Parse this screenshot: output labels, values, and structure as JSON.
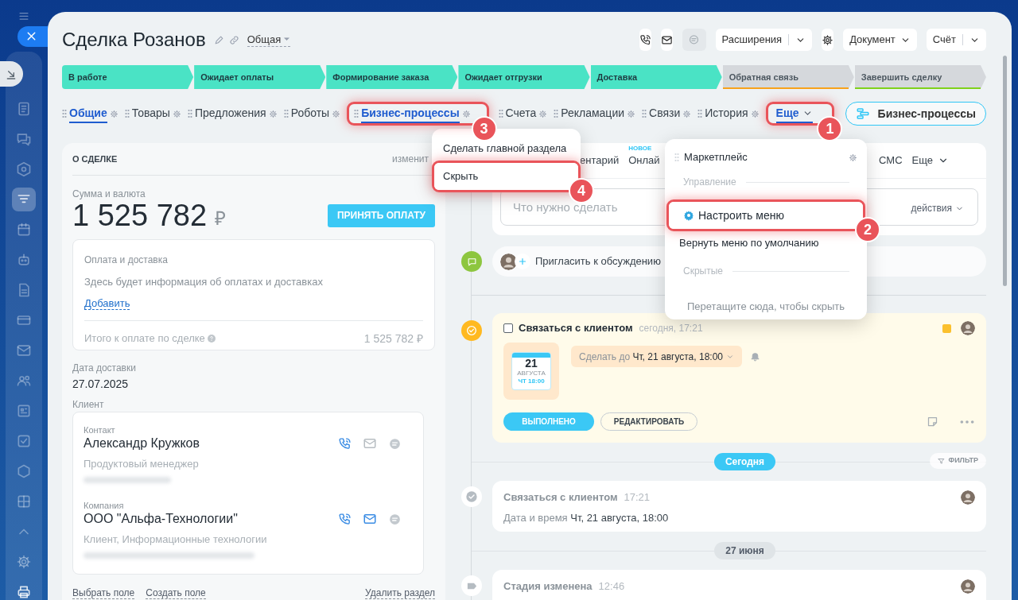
{
  "header": {
    "title": "Сделка Розанов",
    "category": "Общая",
    "buttons": [
      {
        "kind": "call",
        "disabled": false
      },
      {
        "kind": "email",
        "disabled": false
      },
      {
        "kind": "chat",
        "disabled": true
      },
      {
        "kind": "split",
        "label": "Расширения",
        "disabled": false
      },
      {
        "kind": "settings",
        "disabled": false
      },
      {
        "kind": "dropdown",
        "label": "Документ",
        "disabled": false
      },
      {
        "kind": "split",
        "label": "Счёт",
        "disabled": false
      }
    ]
  },
  "stages": [
    {
      "label": "В работе",
      "passed": true
    },
    {
      "label": "Ожидает оплаты",
      "passed": true
    },
    {
      "label": "Формирование заказа",
      "passed": true
    },
    {
      "label": "Ожидает отгрузки",
      "passed": true
    },
    {
      "label": "Доставка",
      "passed": true
    },
    {
      "label": "Обратная связь",
      "passed": false,
      "color": "#f7a21b"
    },
    {
      "label": "Завершить сделку",
      "passed": false,
      "color": "#7fd11b"
    }
  ],
  "tabs": [
    {
      "kind": "tab",
      "label": "Общие",
      "selected": true
    },
    {
      "kind": "tab",
      "label": "Товары",
      "selected": false
    },
    {
      "kind": "tab",
      "label": "Предложения",
      "selected": false
    },
    {
      "kind": "tab",
      "label": "Роботы",
      "selected": false
    },
    {
      "kind": "tab",
      "label": "Бизнес-процессы",
      "selected": true,
      "callout": "3"
    },
    {
      "kind": "tab",
      "label": "Счета",
      "selected": false
    },
    {
      "kind": "tab",
      "label": "Рекламации",
      "selected": false
    },
    {
      "kind": "tab",
      "label": "Связи",
      "selected": false
    },
    {
      "kind": "tab",
      "label": "История",
      "selected": false
    },
    {
      "kind": "more",
      "label": "Еще",
      "selected": true,
      "callout": "1"
    }
  ],
  "process_button": "Бизнес-процессы",
  "deal": {
    "title": "О СДЕЛКЕ",
    "edit_link": "изменит",
    "amount_label": "Сумма и валюта",
    "amount": "1 525 782",
    "currency": "₽",
    "pay_button": "ПРИНЯТЬ ОПЛАТУ",
    "payment": {
      "title": "Оплата и доставка",
      "text": "Здесь будет информация об оплатах и доставках",
      "add_link": "Добавить",
      "total_label": "Итого к оплате по сделке",
      "total": "1 525 782 ₽"
    },
    "fields": [
      {
        "label": "Дата доставки",
        "value": "27.07.2025"
      }
    ],
    "client_label": "Клиент",
    "clients": [
      {
        "type": "Контакт",
        "name": "Александр Кружков",
        "role": "Продуктовый менеджер",
        "email_available": false
      },
      {
        "type": "Компания",
        "name": "ООО \"Альфа-Технологии\"",
        "role": "Клиент, Информационные технологии",
        "email_available": true
      }
    ],
    "footer_links": [
      "Выбрать поле",
      "Создать поле"
    ],
    "delete_link": "Удалить раздел"
  },
  "timeline": {
    "tabs": [
      {
        "kind": "tab",
        "label": "ентарий"
      },
      {
        "kind": "tab",
        "label": "Онлай",
        "badge": "НОВОЕ"
      },
      {
        "kind": "tab",
        "label": "СМС"
      },
      {
        "kind": "more",
        "label": "Еще"
      }
    ],
    "todo_placeholder": "Что нужно сделать",
    "actions": "действия",
    "invite": "Пригласить к обсуждению",
    "task": {
      "checked": false,
      "title": "Связаться с клиентом",
      "time": "сегодня, 17:21",
      "color": "#fbc02d",
      "calendar": {
        "day": "21",
        "month": "АВГУСТА",
        "time": "ЧТ 18:00"
      },
      "deadline": "Сделать до **Чт, 21 августа, 18:00**",
      "done_button": "ВЫПОЛНЕНО",
      "edit_button": "РЕДАКТИРОВАТЬ"
    },
    "events": [
      {
        "kind": "divider",
        "label": "Сегодня",
        "today": true,
        "filter_label": "ФИЛЬТР"
      },
      {
        "kind": "task_done",
        "title": "Связаться с клиентом",
        "time": "17:21",
        "text": "Дата и время **Чт, 21 августа, 18:00**"
      },
      {
        "kind": "divider",
        "label": "27 июня",
        "today": false
      },
      {
        "kind": "stage_change",
        "title": "Стадия изменена",
        "time": "12:46"
      }
    ]
  },
  "context_menu": {
    "items": [
      {
        "label": "Сделать главной раздела"
      },
      {
        "label": "Скрыть",
        "callout": "4"
      }
    ]
  },
  "more_menu": {
    "items": [
      {
        "kind": "item",
        "label": "Маркетплейс"
      },
      {
        "kind": "heading",
        "label": "Управление"
      },
      {
        "kind": "setup",
        "label": "Настроить меню",
        "callout": "2"
      },
      {
        "kind": "action",
        "label": "Вернуть меню по умолчанию"
      },
      {
        "kind": "heading",
        "label": "Скрытые"
      },
      {
        "kind": "hint",
        "label": "Перетащите сюда, чтобы скрыть"
      }
    ]
  }
}
